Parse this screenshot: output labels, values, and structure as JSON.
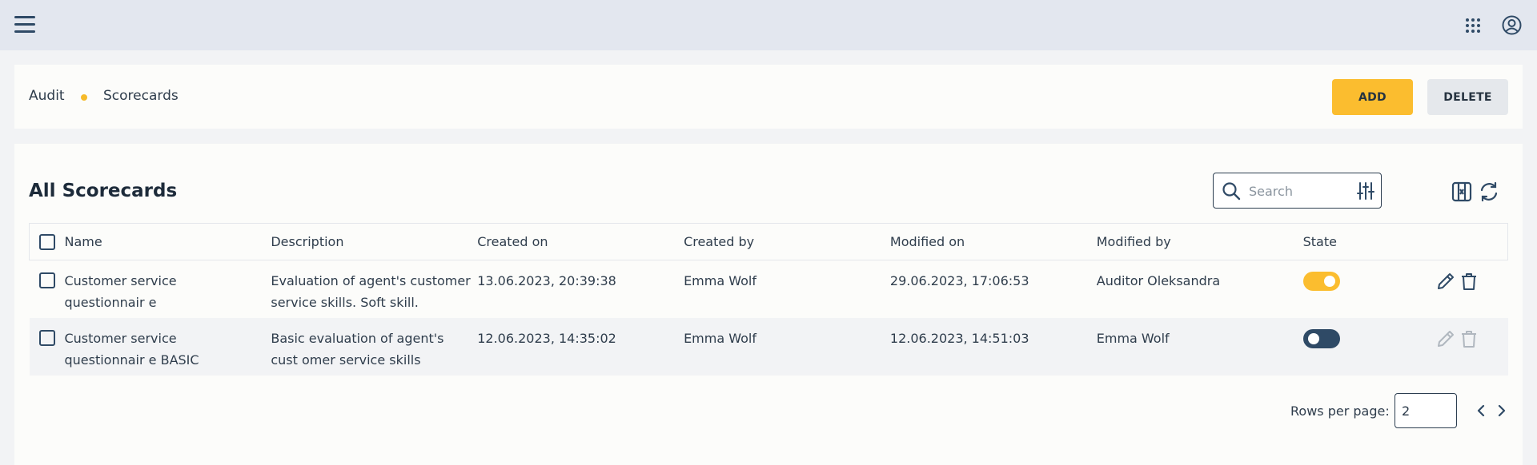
{
  "topbar": {
    "menu_icon": "hamburger-menu-icon",
    "apps_icon": "apps-grid-icon",
    "user_icon": "account-circle-icon"
  },
  "breadcrumb": {
    "items": [
      "Audit",
      "Scorecards"
    ],
    "separator_color": "#f6ba2a"
  },
  "actions": {
    "add_label": "ADD",
    "delete_label": "DELETE",
    "accent": "#fbbd2f"
  },
  "main": {
    "title": "All Scorecards",
    "search": {
      "placeholder": "Search",
      "value": ""
    }
  },
  "table": {
    "columns": [
      "Name",
      "Description",
      "Created on",
      "Created by",
      "Modified on",
      "Modified by",
      "State"
    ],
    "rows": [
      {
        "name": "Customer service questionnair e",
        "description": "Evaluation of agent's customer service skills. Soft skill.",
        "created_on": "13.06.2023, 20:39:38",
        "created_by": "Emma Wolf",
        "modified_on": "29.06.2023, 17:06:53",
        "modified_by": "Auditor Oleksandra",
        "state": "on",
        "actions_enabled": true
      },
      {
        "name": "Customer service questionnair e BASIC",
        "description": "Basic evaluation of agent's cust omer service skills",
        "created_on": "12.06.2023, 14:35:02",
        "created_by": "Emma Wolf",
        "modified_on": "12.06.2023, 14:51:03",
        "modified_by": "Emma Wolf",
        "state": "off",
        "actions_enabled": false
      }
    ]
  },
  "pagination": {
    "rows_per_page_label": "Rows per page:",
    "rows_per_page_value": "2"
  }
}
